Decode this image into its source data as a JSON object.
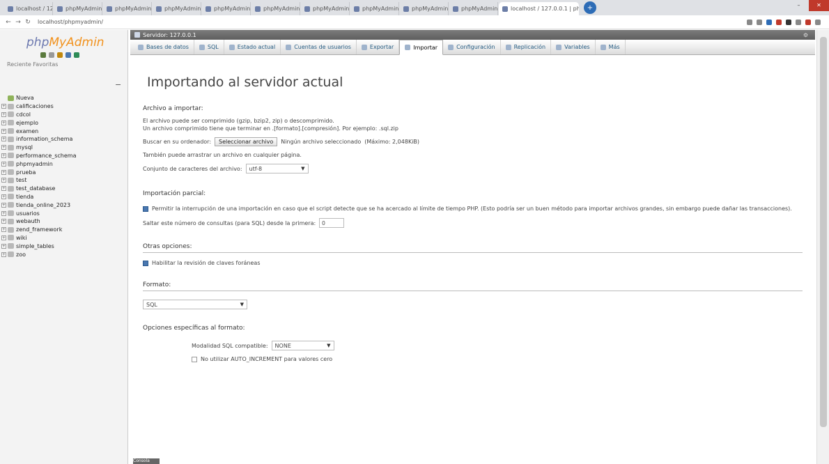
{
  "browser": {
    "tabs": [
      {
        "label": "localhost / 127.0.0.1"
      },
      {
        "label": "phpMyAdmin"
      },
      {
        "label": "phpMyAdmin"
      },
      {
        "label": "phpMyAdmin"
      },
      {
        "label": "phpMyAdmin"
      },
      {
        "label": "phpMyAdmin"
      },
      {
        "label": "phpMyAdmin"
      },
      {
        "label": "phpMyAdmin"
      },
      {
        "label": "phpMyAdmin"
      },
      {
        "label": "phpMyAdmin"
      },
      {
        "label": "localhost / 127.0.0.1 | phpMyAdmin",
        "active": true
      }
    ],
    "url": "localhost/phpmyadmin/",
    "win_minimize": "–",
    "win_close": "✕"
  },
  "sidebar": {
    "logo_part1": "php",
    "logo_part2": "MyAdmin",
    "recent_label": "Reciente  Favoritas",
    "collapse_icon": "−",
    "items": [
      {
        "label": "Nueva",
        "new": true
      },
      {
        "label": "calificaciones"
      },
      {
        "label": "cdcol"
      },
      {
        "label": "ejemplo"
      },
      {
        "label": "examen"
      },
      {
        "label": "information_schema"
      },
      {
        "label": "mysql"
      },
      {
        "label": "performance_schema"
      },
      {
        "label": "phpmyadmin"
      },
      {
        "label": "prueba"
      },
      {
        "label": "test"
      },
      {
        "label": "test_database"
      },
      {
        "label": "tienda"
      },
      {
        "label": "tienda_online_2023"
      },
      {
        "label": "usuarios"
      },
      {
        "label": "webauth"
      },
      {
        "label": "zend_framework"
      },
      {
        "label": "wiki"
      },
      {
        "label": "simple_tables"
      },
      {
        "label": "zoo"
      }
    ]
  },
  "main": {
    "server_label": "Servidor: 127.0.0.1",
    "gear_icon": "⚙",
    "menu": [
      {
        "label": "Bases de datos"
      },
      {
        "label": "SQL"
      },
      {
        "label": "Estado actual"
      },
      {
        "label": "Cuentas de usuarios"
      },
      {
        "label": "Exportar"
      },
      {
        "label": "Importar",
        "active": true
      },
      {
        "label": "Configuración"
      },
      {
        "label": "Replicación"
      },
      {
        "label": "Variables"
      },
      {
        "label": "Más"
      }
    ],
    "title": "Importando al servidor actual",
    "file_section": {
      "heading": "Archivo a importar:",
      "line1": "El archivo puede ser comprimido (gzip, bzip2, zip) o descomprimido.",
      "line2": "Un archivo comprimido tiene que terminar en .[formato].[compresión]. Por ejemplo: .sql.zip",
      "browse_label": "Buscar en su ordenador:",
      "browse_button": "Seleccionar archivo",
      "no_file": "Ningún archivo seleccionado",
      "max_size": "(Máximo: 2,048KiB)",
      "drag_text": "También puede arrastrar un archivo en cualquier página.",
      "charset_label": "Conjunto de caracteres del archivo:",
      "charset_value": "utf-8"
    },
    "partial_section": {
      "heading": "Importación parcial:",
      "allow_interrupt": "Permitir la interrupción de una importación en caso que el script detecte que se ha acercado al límite de tiempo PHP. (Esto podría ser un buen método para importar archivos grandes, sin embargo puede dañar las transacciones).",
      "skip_label": "Saltar este número de consultas (para SQL) desde la primera:",
      "skip_value": "0"
    },
    "other_section": {
      "heading": "Otras opciones:",
      "fk_label": "Habilitar la revisión de claves foráneas"
    },
    "format_section": {
      "heading": "Formato:",
      "format_value": "SQL"
    },
    "specific_section": {
      "heading": "Opciones específicas al formato:",
      "compat_label": "Modalidad SQL compatible:",
      "compat_value": "NONE",
      "no_auto_label": "No utilizar AUTO_INCREMENT para valores cero"
    }
  },
  "bottom_label": "Consola",
  "colors": {
    "logo_php": "#6c78af",
    "logo_myadmin": "#f2911b",
    "link": "#235a81"
  }
}
